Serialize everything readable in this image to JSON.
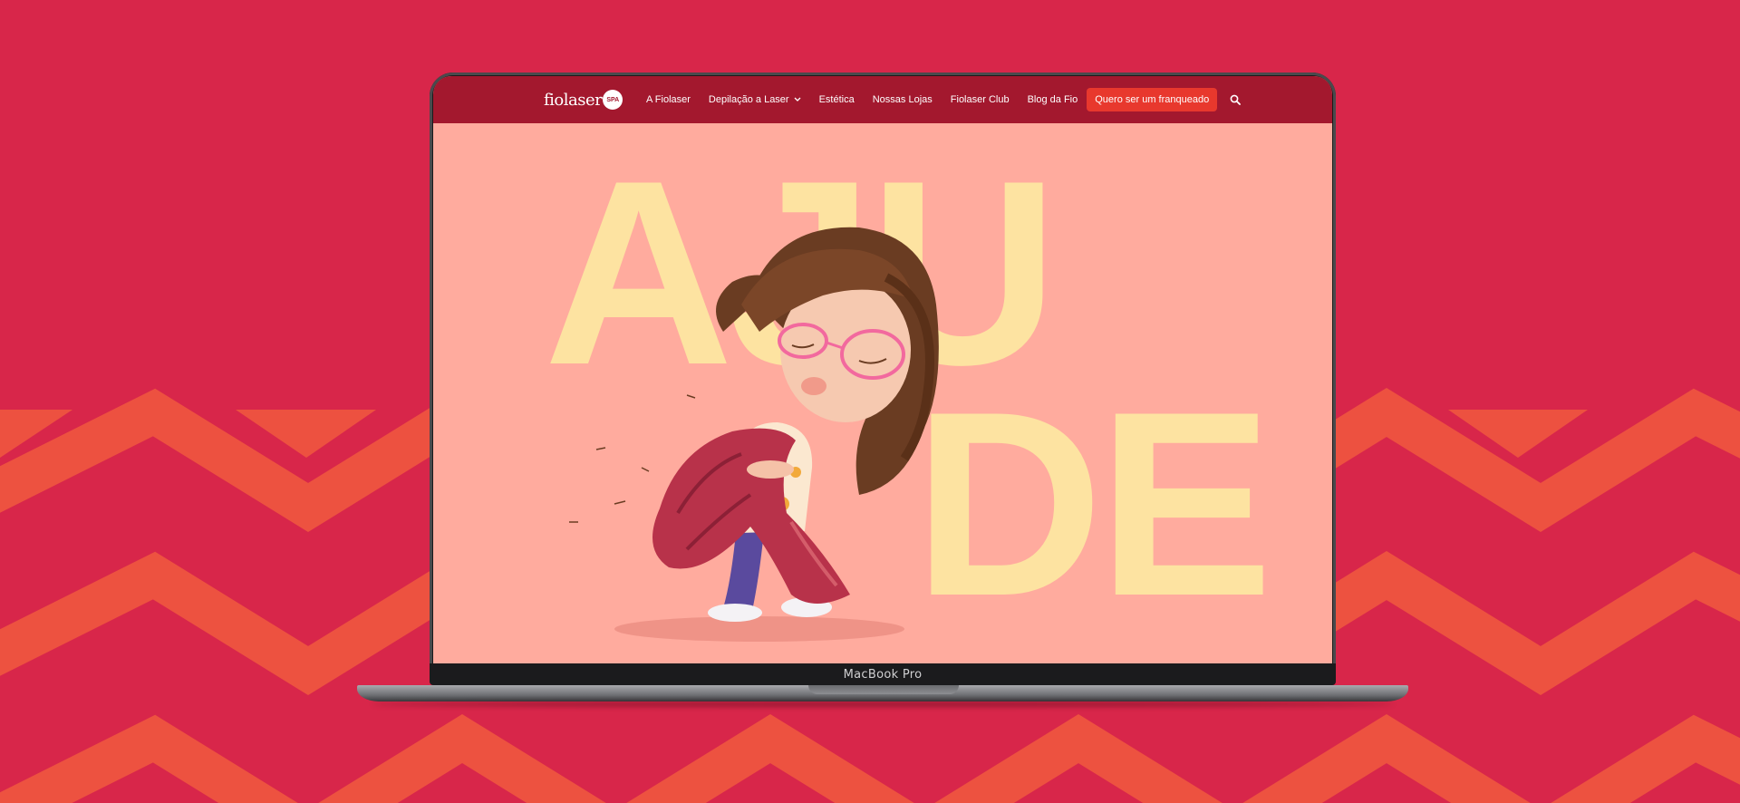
{
  "device": {
    "model_label": "MacBook Pro"
  },
  "site": {
    "logo": {
      "text": "fiolaser",
      "badge": "SPA"
    },
    "nav": {
      "items": [
        {
          "label": "A Fiolaser",
          "has_dropdown": false
        },
        {
          "label": "Depilação a Laser",
          "has_dropdown": true
        },
        {
          "label": "Estética",
          "has_dropdown": false
        },
        {
          "label": "Nossas Lojas",
          "has_dropdown": false
        },
        {
          "label": "Fiolaser Club",
          "has_dropdown": false
        },
        {
          "label": "Blog da Fio",
          "has_dropdown": false
        }
      ],
      "cta_label": "Quero ser um franqueado",
      "search_icon": "search-icon"
    },
    "hero": {
      "word_top": "AJU",
      "word_bottom": "DE"
    }
  },
  "colors": {
    "page_background": "#d8264a",
    "zigzag": "#f0573f",
    "nav_background": "#a3182e",
    "cta_background": "#e8382d",
    "hero_background": "#ffab9e",
    "hero_letters": "#fde3a1"
  }
}
